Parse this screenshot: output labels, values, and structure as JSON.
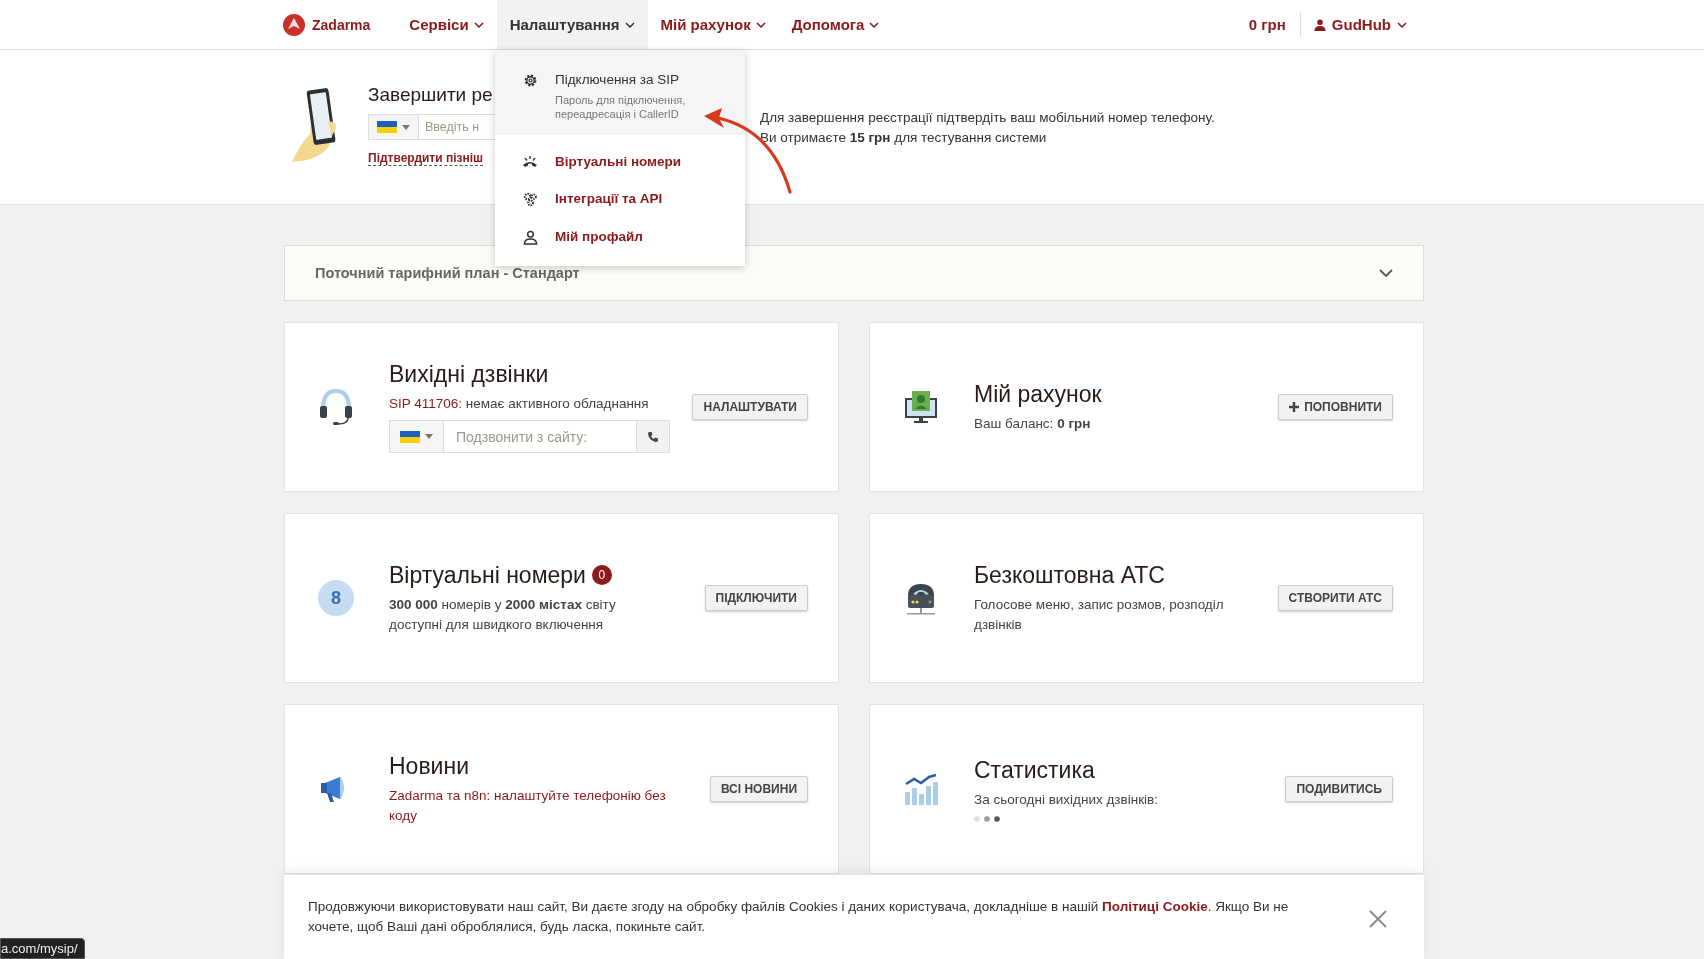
{
  "header": {
    "logo": "Zadarma",
    "nav": [
      {
        "label": "Сервіси",
        "selected": false
      },
      {
        "label": "Налаштування",
        "selected": true
      },
      {
        "label": "Мій рахунок",
        "selected": false
      },
      {
        "label": "Допомога",
        "selected": false
      }
    ],
    "balance": "0 грн",
    "user": "GudHub"
  },
  "dropdown": {
    "items": [
      {
        "title": "Підключення за SIP",
        "description": "Пароль для підключення, переадресація і CallerID",
        "selected": true
      },
      {
        "title": "Віртуальні номери",
        "selected": false
      },
      {
        "title": "Інтеграції та API",
        "selected": false
      },
      {
        "title": "Мій профайл",
        "selected": false
      }
    ]
  },
  "registration": {
    "title": "Завершити ре",
    "phone_placeholder": "Введіть н",
    "later_link": "Підтвердити пізніш",
    "note_lines": [
      "Для завершення реєстрації підтвердіть ваш мобільний номер телефону.",
      "Ви отримаєте **15 грн** для тестування системи"
    ]
  },
  "tariff": {
    "label": "Поточний тарифний план - Стандарт",
    "expanded": false
  },
  "cards": [
    {
      "kind": "outgoing",
      "title": "Вихідні дзвінки",
      "link": "SIP 411706:",
      "text": "немає активного обладнання",
      "call_placeholder": "Подзвонити з сайту:",
      "button": "НАЛАШТУВАТИ"
    },
    {
      "kind": "account",
      "title": "Мій рахунок",
      "text": "Ваш баланс: **0 грн**",
      "button": "ПОПОВНИТИ",
      "button_plus": true
    },
    {
      "kind": "virtual",
      "title": "Віртуальні номери",
      "badge": "0",
      "icon_text": "8",
      "text": "**300 000** номерів у **2000 містах** світу доступні для швидкого включення",
      "button": "ПІДКЛЮЧИТИ"
    },
    {
      "kind": "pbx",
      "title": "Безкоштовна АТС",
      "text": "Голосове меню, запис розмов, розподіл дзвінків",
      "button": "СТВОРИТИ АТС"
    },
    {
      "kind": "news",
      "title": "Новини",
      "link": "Zadarma та n8n: налаштуйте телефонію без коду",
      "button": "ВСІ НОВИНИ"
    },
    {
      "kind": "stats",
      "title": "Статистика",
      "text": "За сьогодні вихідних дзвінків:",
      "loading": true,
      "button": "ПОДИВИТИСЬ"
    }
  ],
  "cookie": {
    "before": "Продовжуючи використовувати наш сайт, Ви даєте згоду на обробку файлів Cookies і даних користувача, докладніше в нашій",
    "link": "Політиці Cookie",
    "after": ". Якщо Ви не хочете, щоб Ваші дані оброблялися, будь ласка, покиньте сайт."
  },
  "status_url": "a.com/mysip/"
}
